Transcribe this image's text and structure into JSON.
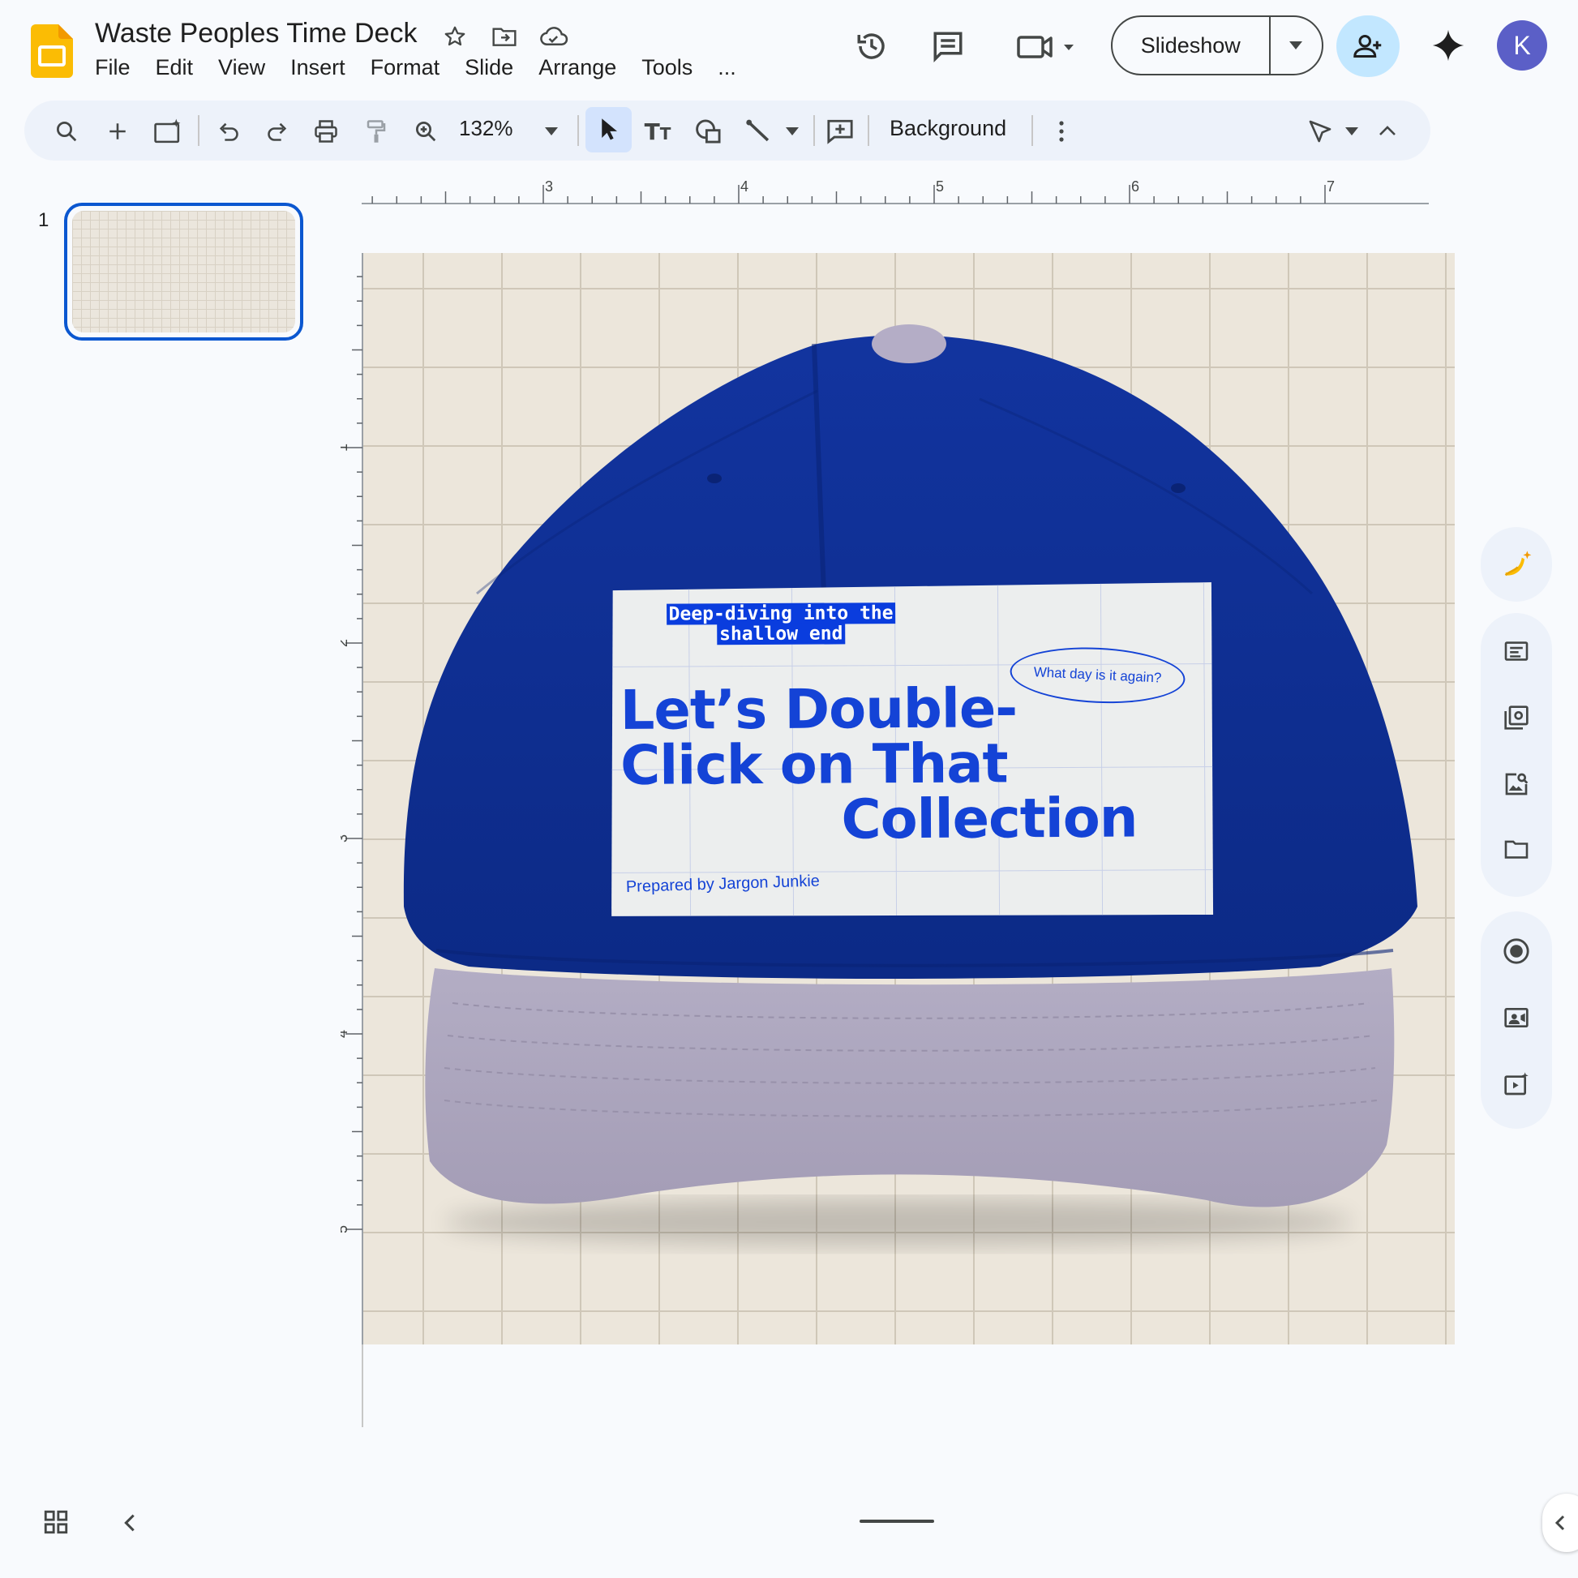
{
  "app": {
    "name": "Google Slides",
    "icon": "slides-logo-icon",
    "accent": "#fbbc04"
  },
  "doc": {
    "title": "Waste Peoples Time Deck"
  },
  "menu": {
    "items": [
      "File",
      "Edit",
      "View",
      "Insert",
      "Format",
      "Slide",
      "Arrange",
      "Tools",
      "..."
    ]
  },
  "header_actions": {
    "slideshow_label": "Slideshow",
    "avatar_initial": "K",
    "avatar_color": "#5b5fc7",
    "share_color": "#c2e7ff"
  },
  "toolbar": {
    "zoom": "132%",
    "background_label": "Background"
  },
  "filmstrip": {
    "slides": [
      {
        "number": "1"
      }
    ]
  },
  "rulers": {
    "horizontal": [
      "3",
      "4",
      "5",
      "6",
      "7"
    ],
    "vertical": [
      "1",
      "2",
      "3",
      "4",
      "5"
    ]
  },
  "slide": {
    "background": "#ece6db",
    "cap": {
      "crown_color": "#0e2f95",
      "visor_color": "#aba4bd"
    },
    "patch": {
      "tagline": "Deep-diving into the shallow end",
      "tagline_line1": "Deep-diving into the",
      "tagline_line2": "shallow end",
      "title_line1": "Let’s Double-",
      "title_line2": "Click on That",
      "title_line3": "Collection",
      "oval_text": "What day is it again?",
      "byline": "Prepared by Jargon Junkie",
      "text_color": "#1443d6"
    }
  }
}
